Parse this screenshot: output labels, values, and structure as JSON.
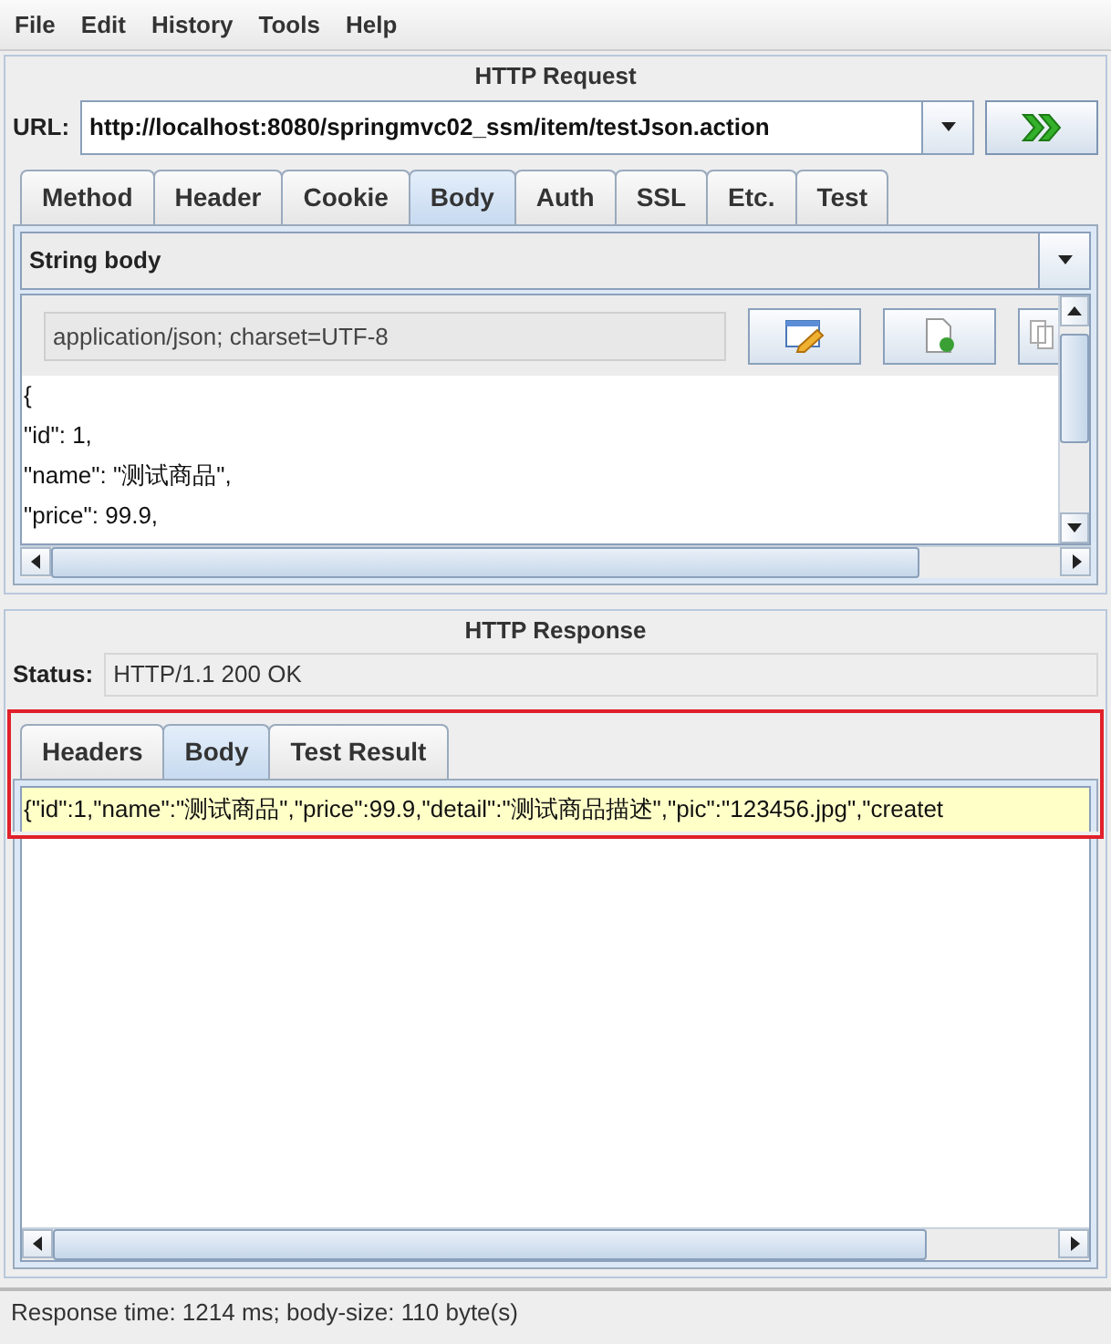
{
  "menu": [
    "File",
    "Edit",
    "History",
    "Tools",
    "Help"
  ],
  "request": {
    "title": "HTTP Request",
    "url_label": "URL:",
    "url": "http://localhost:8080/springmvc02_ssm/item/testJson.action",
    "tabs": [
      {
        "label": "Method",
        "selected": false
      },
      {
        "label": "Header",
        "selected": false
      },
      {
        "label": "Cookie",
        "selected": false
      },
      {
        "label": "Body",
        "selected": true
      },
      {
        "label": "Auth",
        "selected": false
      },
      {
        "label": "SSL",
        "selected": false
      },
      {
        "label": "Etc.",
        "selected": false
      },
      {
        "label": "Test",
        "selected": false
      }
    ],
    "body_type": "String body",
    "content_type": "application/json; charset=UTF-8",
    "body_lines": [
      "{",
      "\"id\": 1,",
      "\"name\": \"测试商品\",",
      "\"price\": 99.9,"
    ]
  },
  "response": {
    "title": "HTTP Response",
    "status_label": "Status:",
    "status": "HTTP/1.1 200 OK",
    "tabs": [
      {
        "label": "Headers",
        "selected": false
      },
      {
        "label": "Body",
        "selected": true
      },
      {
        "label": "Test Result",
        "selected": false
      }
    ],
    "highlighted": true,
    "body": "{\"id\":1,\"name\":\"测试商品\",\"price\":99.9,\"detail\":\"测试商品描述\",\"pic\":\"123456.jpg\",\"createt"
  },
  "status_bar": "Response time: 1214 ms; body-size: 110 byte(s)"
}
